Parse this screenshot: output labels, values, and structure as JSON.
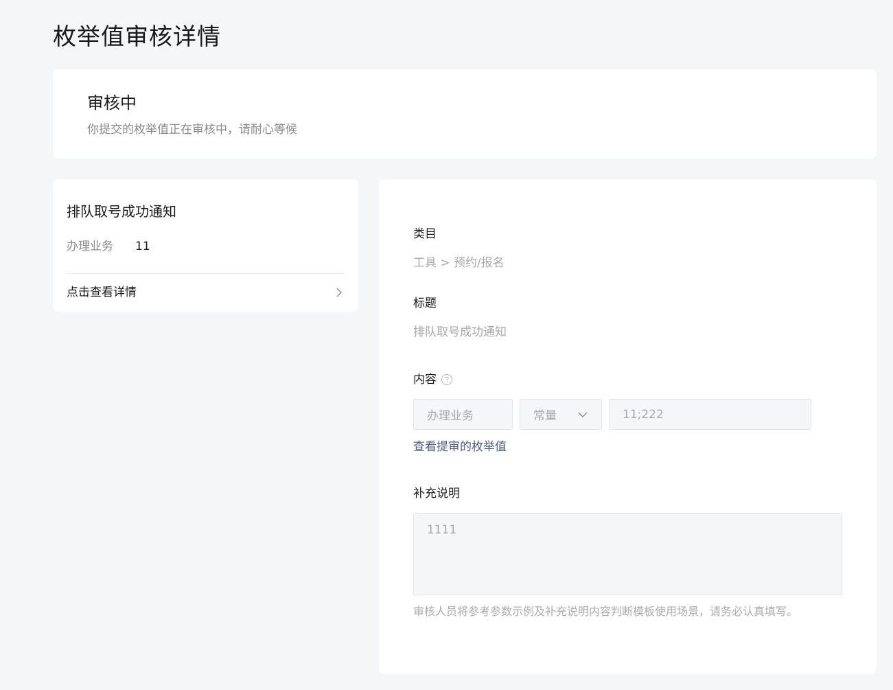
{
  "page": {
    "title": "枚举值审核详情"
  },
  "status": {
    "title": "审核中",
    "description": "你提交的枚举值正在审核中，请耐心等候"
  },
  "preview": {
    "title": "排队取号成功通知",
    "row_key": "办理业务",
    "row_value": "11",
    "link_label": "点击查看详情"
  },
  "detail": {
    "category_label": "类目",
    "category_value": "工具 > 预约/报名",
    "title_label": "标题",
    "title_value": "排队取号成功通知",
    "content_label": "内容",
    "content_field_name": "办理业务",
    "content_field_type": "常量",
    "content_field_value": "11;222",
    "view_enum_link": "查看提审的枚举值",
    "supplement_label": "补充说明",
    "supplement_value": "1111",
    "hint": "审核人员将参考参数示例及补充说明内容判断模板使用场景，请务必认真填写。"
  },
  "icons": {
    "help": "question-circle-icon",
    "chevron_right": "chevron-right-icon",
    "chevron_down": "chevron-down-icon"
  },
  "colors": {
    "background": "#f5f6f7",
    "card": "#ffffff",
    "link": "#4a5a80",
    "muted": "#a8a8a8"
  }
}
